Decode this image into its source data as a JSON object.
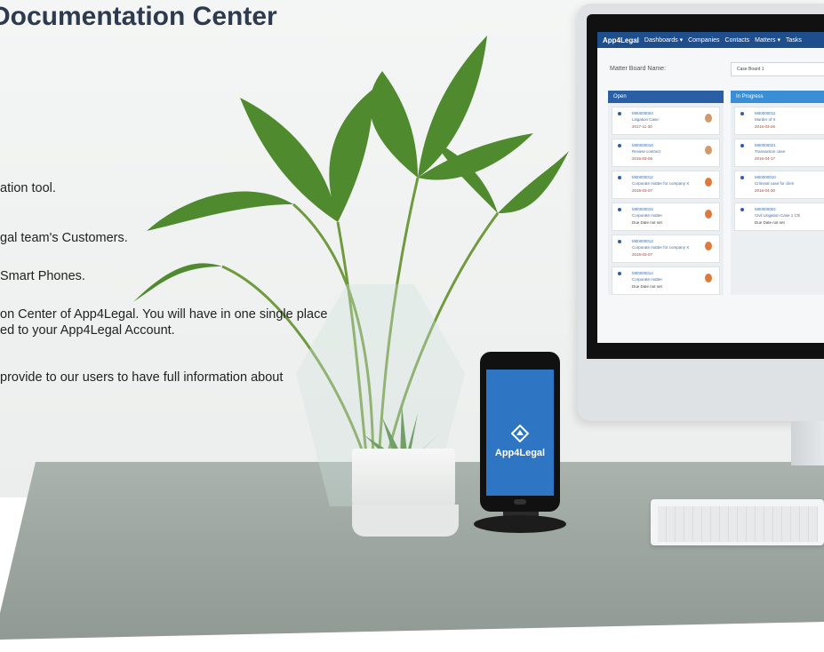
{
  "page": {
    "title": "Documentation Center",
    "lines": [
      "ation tool.",
      "gal team's Customers.",
      "Smart Phones.",
      "on Center of App4Legal. You will have in one single place",
      "ed to your App4Legal Account.",
      "provide to our users to have full information about"
    ]
  },
  "monitor": {
    "app_name": "App4Legal",
    "nav": [
      "Dashboards ▾",
      "Companies",
      "Contacts",
      "Matters ▾",
      "Tasks"
    ],
    "board_label": "Matter Board Name:",
    "board_select": "Case Board 1",
    "columns": [
      {
        "title": "Open",
        "cards": [
          {
            "id": "M00000004",
            "name": "Litigation Case",
            "date": "2017-11-30"
          },
          {
            "id": "M00000018",
            "name": "Review contract",
            "date": "2016-03-06"
          },
          {
            "id": "M00000012",
            "name": "Corporate matter for company X",
            "date": "2016-03-07"
          },
          {
            "id": "M00000015",
            "name": "Corporate matter",
            "date": "Due Date not set"
          },
          {
            "id": "M00000013",
            "name": "Corporate matter for company X",
            "date": "2016-03-07"
          },
          {
            "id": "M00000014",
            "name": "Corporate matter",
            "date": "Due Date not set"
          }
        ]
      },
      {
        "title": "In Progress",
        "cards": [
          {
            "id": "M00000011",
            "name": "Murder of X",
            "date": "2016-03-26"
          },
          {
            "id": "M00000021",
            "name": "Transaction case",
            "date": "2016-04-17"
          },
          {
            "id": "M00000010",
            "name": "Criminal case for clien",
            "date": "2016-04-30"
          },
          {
            "id": "M00000002",
            "name": "Civil Litigation Case 1 Chi",
            "date": "Due Date not set"
          }
        ]
      }
    ]
  },
  "phone": {
    "app_name": "App4Legal"
  },
  "colors": {
    "title": "#2e3b4e",
    "brand_blue": "#2e76c3",
    "nav_blue": "#1f4e8c"
  }
}
